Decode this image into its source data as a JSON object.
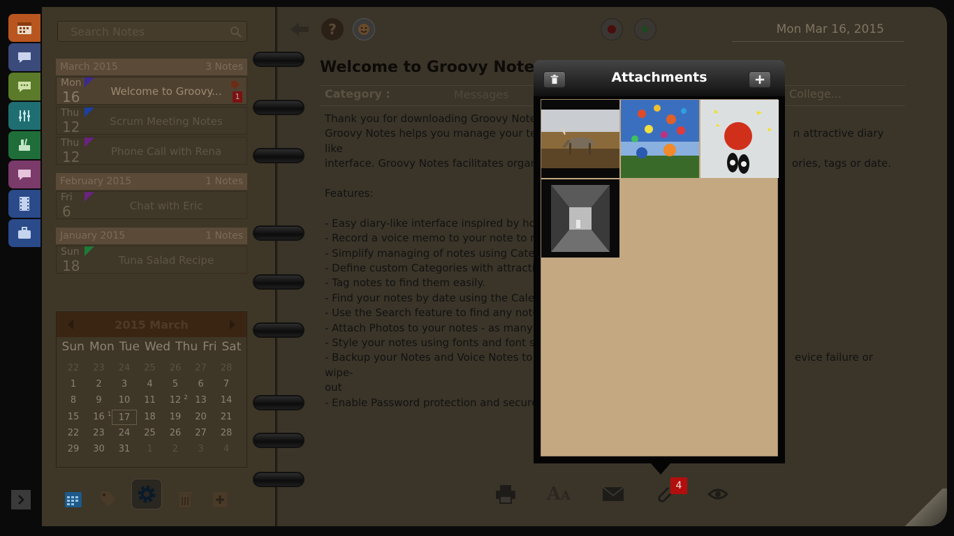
{
  "search": {
    "placeholder": "Search Notes"
  },
  "groups": [
    {
      "month": "March 2015",
      "count": "3 Notes",
      "notes": [
        {
          "day_name": "Mon",
          "day_num": "16",
          "title": "Welcome to Groovy...",
          "flag_color": "#3b2a8f",
          "badge": "1",
          "selected": true
        },
        {
          "day_name": "Thu",
          "day_num": "12",
          "title": "Scrum Meeting Notes",
          "flag_color": "#1c3fa0"
        },
        {
          "day_name": "Thu",
          "day_num": "12",
          "title": "Phone Call with Rena",
          "flag_color": "#6a2380"
        }
      ]
    },
    {
      "month": "February 2015",
      "count": "1 Notes",
      "notes": [
        {
          "day_name": "Fri",
          "day_num": "6",
          "title": "Chat with Eric",
          "flag_color": "#6a2380"
        }
      ]
    },
    {
      "month": "January 2015",
      "count": "1 Notes",
      "notes": [
        {
          "day_name": "Sun",
          "day_num": "18",
          "title": "Tuna Salad Recipe",
          "flag_color": "#1d7a3a"
        }
      ]
    }
  ],
  "calendar": {
    "title": "2015 March",
    "weekdays": [
      "Sun",
      "Mon",
      "Tue",
      "Wed",
      "Thu",
      "Fri",
      "Sat"
    ],
    "weeks": [
      [
        "22",
        "23",
        "24",
        "25",
        "26",
        "27",
        "28"
      ],
      [
        "1",
        "2",
        "3",
        "4",
        "5",
        "6",
        "7"
      ],
      [
        "8",
        "9",
        "10",
        "11",
        "12",
        "13",
        "14"
      ],
      [
        "15",
        "16",
        "17",
        "18",
        "19",
        "20",
        "21"
      ],
      [
        "22",
        "23",
        "24",
        "25",
        "26",
        "27",
        "28"
      ],
      [
        "29",
        "30",
        "31",
        "1",
        "2",
        "3",
        "4"
      ]
    ],
    "today": "17",
    "marks": {
      "12": "2",
      "16": "1"
    }
  },
  "header": {
    "date": "Mon Mar 16, 2015"
  },
  "note": {
    "title": "Welcome to Groovy Notes!",
    "category_label": "Category :",
    "category_value": "Messages",
    "category_value_right": "College...",
    "paragraphs": [
      "Thank you for downloading Groovy Notes!",
      "Groovy Notes helps you manage your text                                                                          n attractive diary like",
      "interface. Groovy Notes facilitates organiz                                                                          ories, tags or date.",
      "",
      "Features:",
      "",
      "- Easy diary-like interface inspired by how y",
      "- Record a voice memo to your note to ma",
      "- Simplify managing of notes using Catego",
      "- Define custom Categories with attractive",
      "- Tag notes to find them easily.",
      "- Find your notes by date using the Calend",
      "- Use the Search feature to find any note in",
      "- Attach Photos to your notes - as many as",
      "- Style your notes using fonts and font size",
      "- Backup your Notes and Voice Notes to yo                                                                          evice failure or wipe-",
      "out",
      "- Enable Password protection and secure y"
    ]
  },
  "attachments": {
    "title": "Attachments",
    "count": "4",
    "items": [
      {
        "name": "attachment-deer-photo"
      },
      {
        "name": "attachment-balloons-photo"
      },
      {
        "name": "attachment-red-umbrella-photo"
      },
      {
        "name": "attachment-tunnel-photo"
      }
    ]
  },
  "colors": {
    "accent_red": "#b30e0e",
    "popover_bg": "#050505",
    "attachment_panel": "#c4a882"
  }
}
